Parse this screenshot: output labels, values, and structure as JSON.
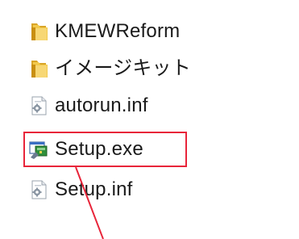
{
  "files": [
    {
      "name": "KMEWReform",
      "icon": "folder-icon"
    },
    {
      "name": "イメージキット",
      "icon": "folder-icon"
    },
    {
      "name": "autorun.inf",
      "icon": "settings-file-icon"
    },
    {
      "name": "Setup.exe",
      "icon": "setup-exe-icon",
      "highlighted": true
    },
    {
      "name": "Setup.inf",
      "icon": "settings-file-icon"
    }
  ],
  "highlight": {
    "color": "#e8253a"
  }
}
